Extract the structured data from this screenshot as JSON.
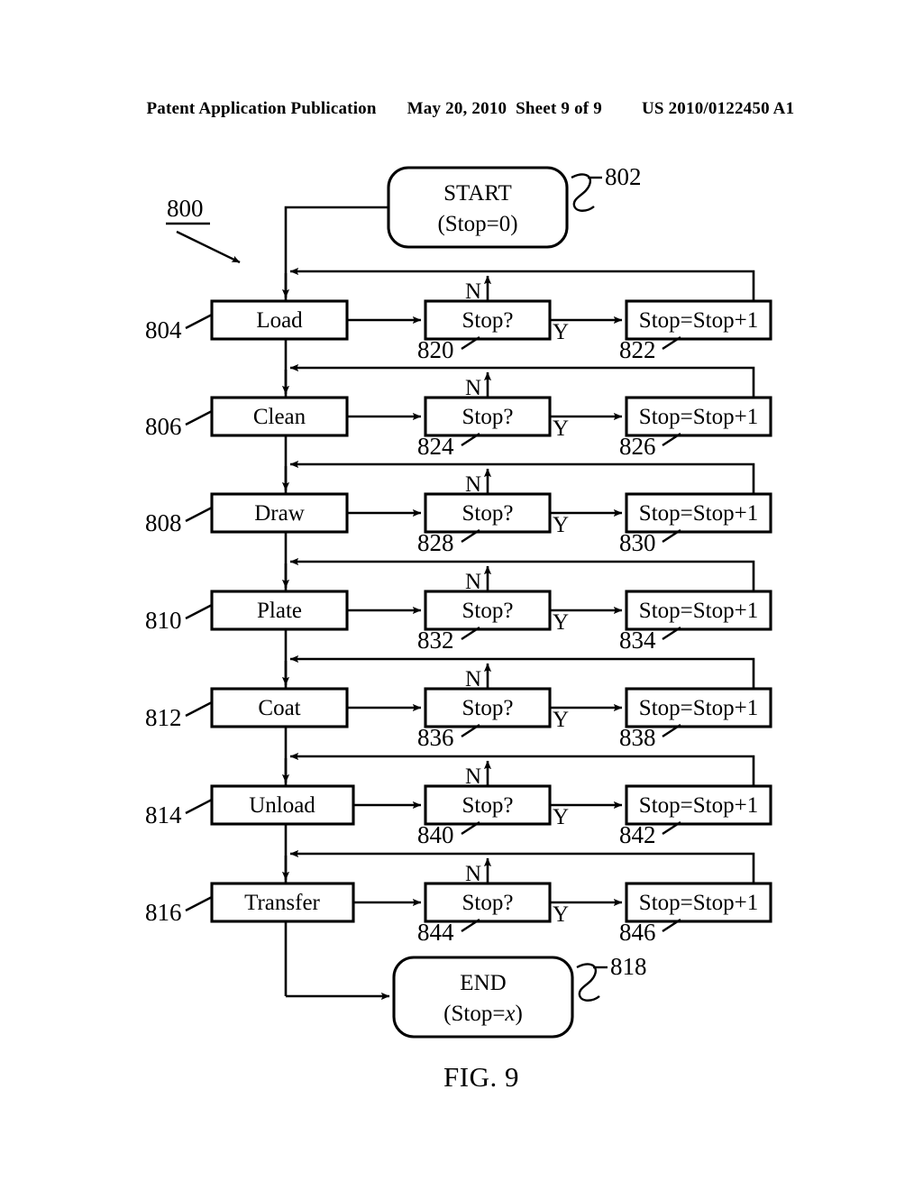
{
  "header": {
    "publication": "Patent Application Publication",
    "date": "May 20, 2010",
    "sheet": "Sheet 9 of 9",
    "docnumber": "US 2010/0122450 A1"
  },
  "figure": {
    "caption": "FIG. 9",
    "diagram_ref": "800",
    "start": {
      "line1": "START",
      "line2": "(Stop=0)",
      "ref": "802"
    },
    "end": {
      "line1": "END",
      "line2_pre": "(Stop=",
      "line2_italic": "x",
      "line2_post": ")",
      "ref": "818"
    },
    "branch_no": "N",
    "branch_yes": "Y",
    "decision_label": "Stop?",
    "increment_label": "Stop=Stop+1",
    "rows": [
      {
        "process": "Load",
        "process_ref": "804",
        "decision_ref": "820",
        "increment_ref": "822"
      },
      {
        "process": "Clean",
        "process_ref": "806",
        "decision_ref": "824",
        "increment_ref": "826"
      },
      {
        "process": "Draw",
        "process_ref": "808",
        "decision_ref": "828",
        "increment_ref": "830"
      },
      {
        "process": "Plate",
        "process_ref": "810",
        "decision_ref": "832",
        "increment_ref": "834"
      },
      {
        "process": "Coat",
        "process_ref": "812",
        "decision_ref": "836",
        "increment_ref": "838"
      },
      {
        "process": "Unload",
        "process_ref": "814",
        "decision_ref": "840",
        "increment_ref": "842"
      },
      {
        "process": "Transfer",
        "process_ref": "816",
        "decision_ref": "844",
        "increment_ref": "846"
      }
    ]
  },
  "colors": {
    "ink": "#000000",
    "paper": "#ffffff"
  }
}
